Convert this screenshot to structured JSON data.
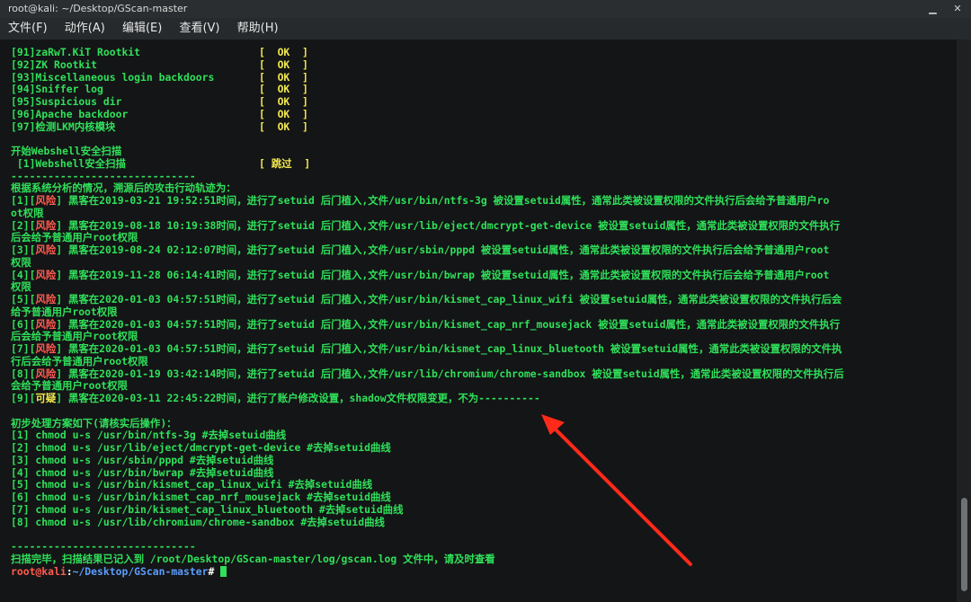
{
  "window": {
    "title": "root@kali: ~/Desktop/GScan-master",
    "controls": [
      "▁",
      "✕"
    ]
  },
  "menu": [
    "文件(F)",
    "动作(A)",
    "编辑(E)",
    "查看(V)",
    "帮助(H)"
  ],
  "checks": [
    {
      "name": "[91]zaRwT.KiT Rootkit",
      "status": "[  OK  ]"
    },
    {
      "name": "[92]ZK Rootkit",
      "status": "[  OK  ]"
    },
    {
      "name": "[93]Miscellaneous login backdoors",
      "status": "[  OK  ]"
    },
    {
      "name": "[94]Sniffer log",
      "status": "[  OK  ]"
    },
    {
      "name": "[95]Suspicious dir",
      "status": "[  OK  ]"
    },
    {
      "name": "[96]Apache backdoor",
      "status": "[  OK  ]"
    },
    {
      "name": "[97]检测LKM内核模块",
      "status": "[  OK  ]"
    }
  ],
  "webshell": {
    "title": "开始Webshell安全扫描",
    "item": " [1]Webshell安全扫描",
    "status_open": "[ ",
    "status": "跳过",
    "status_close": "  ]"
  },
  "separator": "------------------------------",
  "trace_title": "根据系统分析的情况，溯源后的攻击行动轨迹为：",
  "events": [
    {
      "prefix": "[1][",
      "tag": "风险",
      "suffix": "] 黑客在2019-03-21 19:52:51时间，进行了setuid 后门植入,文件/usr/bin/ntfs-3g 被设置setuid属性，通常此类被设置权限的文件执行后会给予普通用户ro",
      "cont": "ot权限"
    },
    {
      "prefix": "[2][",
      "tag": "风险",
      "suffix": "] 黑客在2019-08-18 10:19:38时间，进行了setuid 后门植入,文件/usr/lib/eject/dmcrypt-get-device 被设置setuid属性，通常此类被设置权限的文件执行",
      "cont": "后会给予普通用户root权限"
    },
    {
      "prefix": "[3][",
      "tag": "风险",
      "suffix": "] 黑客在2019-08-24 02:12:07时间，进行了setuid 后门植入,文件/usr/sbin/pppd 被设置setuid属性，通常此类被设置权限的文件执行后会给予普通用户root",
      "cont": "权限"
    },
    {
      "prefix": "[4][",
      "tag": "风险",
      "suffix": "] 黑客在2019-11-28 06:14:41时间，进行了setuid 后门植入,文件/usr/bin/bwrap 被设置setuid属性，通常此类被设置权限的文件执行后会给予普通用户root",
      "cont": "权限"
    },
    {
      "prefix": "[5][",
      "tag": "风险",
      "suffix": "] 黑客在2020-01-03 04:57:51时间，进行了setuid 后门植入,文件/usr/bin/kismet_cap_linux_wifi 被设置setuid属性，通常此类被设置权限的文件执行后会",
      "cont": "给予普通用户root权限"
    },
    {
      "prefix": "[6][",
      "tag": "风险",
      "suffix": "] 黑客在2020-01-03 04:57:51时间，进行了setuid 后门植入,文件/usr/bin/kismet_cap_nrf_mousejack 被设置setuid属性，通常此类被设置权限的文件执行",
      "cont": "后会给予普通用户root权限"
    },
    {
      "prefix": "[7][",
      "tag": "风险",
      "suffix": "] 黑客在2020-01-03 04:57:51时间，进行了setuid 后门植入,文件/usr/bin/kismet_cap_linux_bluetooth 被设置setuid属性，通常此类被设置权限的文件执",
      "cont": "行后会给予普通用户root权限"
    },
    {
      "prefix": "[8][",
      "tag": "风险",
      "suffix": "] 黑客在2020-01-19 03:42:14时间，进行了setuid 后门植入,文件/usr/lib/chromium/chrome-sandbox 被设置setuid属性，通常此类被设置权限的文件执行后",
      "cont": "会给予普通用户root权限"
    }
  ],
  "event9": {
    "prefix": "[9][",
    "tag": "可疑",
    "suffix": "] 黑客在2020-03-11 22:45:22时间，进行了账户修改设置，shadow文件权限变更，不为----------"
  },
  "plan_title": "初步处理方案如下(请核实后操作)：",
  "plan": [
    "[1] chmod u-s /usr/bin/ntfs-3g #去掉setuid曲线",
    "[2] chmod u-s /usr/lib/eject/dmcrypt-get-device #去掉setuid曲线",
    "[3] chmod u-s /usr/sbin/pppd #去掉setuid曲线",
    "[4] chmod u-s /usr/bin/bwrap #去掉setuid曲线",
    "[5] chmod u-s /usr/bin/kismet_cap_linux_wifi #去掉setuid曲线",
    "[6] chmod u-s /usr/bin/kismet_cap_nrf_mousejack #去掉setuid曲线",
    "[7] chmod u-s /usr/bin/kismet_cap_linux_bluetooth #去掉setuid曲线",
    "[8] chmod u-s /usr/lib/chromium/chrome-sandbox #去掉setuid曲线"
  ],
  "final_msg": "扫描完毕，扫描结果已记入到 /root/Desktop/GScan-master/log/gscan.log 文件中，请及时查看",
  "prompt": {
    "user": "root@kali",
    "colon": ":",
    "path": "~/Desktop/GScan-master",
    "hash": "# "
  },
  "colors": {
    "green": "#2fe05a",
    "yellow": "#f2e94e",
    "red": "#ff5b50",
    "arrow": "#ff2a1a"
  }
}
